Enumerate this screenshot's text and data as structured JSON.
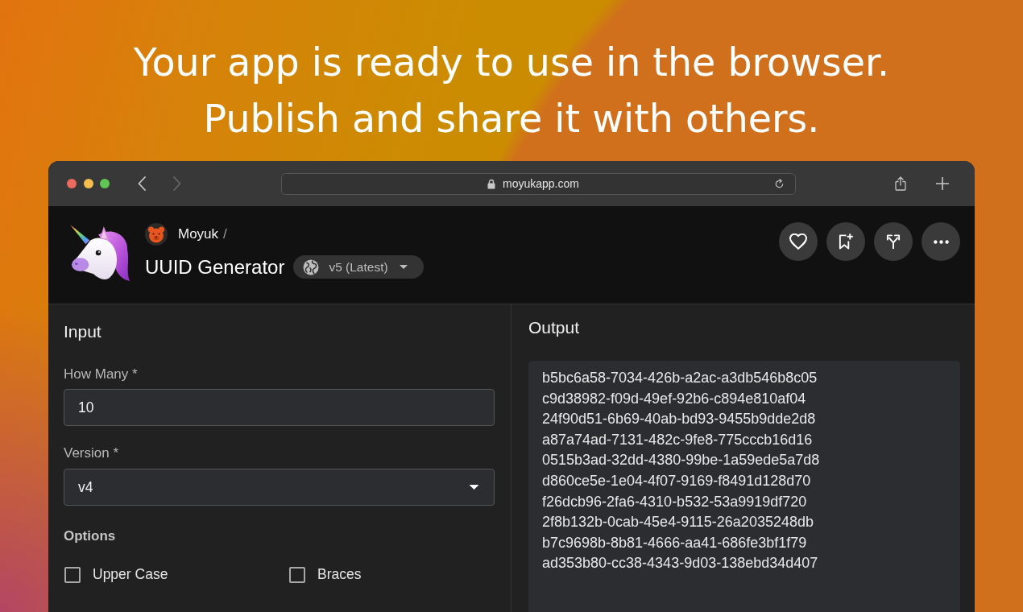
{
  "headline": [
    "Your app is ready to use in the browser.",
    "Publish and share it with others."
  ],
  "browser": {
    "nav": [
      {
        "kind": "back",
        "disabled": false
      },
      {
        "kind": "forward",
        "disabled": true
      }
    ],
    "url": "moyukapp.com"
  },
  "app": {
    "owner": "Moyuk",
    "separator": "/",
    "title": "UUID Generator",
    "version": "v5 (Latest)"
  },
  "input": {
    "heading": "Input",
    "fields": [
      {
        "kind": "number",
        "label": "How Many *",
        "value": "10"
      },
      {
        "kind": "select",
        "label": "Version *",
        "value": "v4"
      }
    ],
    "options_heading": "Options",
    "options": [
      {
        "label": "Upper Case",
        "checked": false
      },
      {
        "label": "Braces",
        "checked": false
      }
    ]
  },
  "output": {
    "heading": "Output",
    "lines": [
      "b5bc6a58-7034-426b-a2ac-a3db546b8c05",
      "c9d38982-f09d-49ef-92b6-c894e810af04",
      "24f90d51-6b69-40ab-bd93-9455b9dde2d8",
      "a87a74ad-7131-482c-9fe8-775cccb16d16",
      "0515b3ad-32dd-4380-99be-1a59ede5a7d8",
      "d860ce5e-1e04-4f07-9169-f8491d128d70",
      "f26dcb96-2fa6-4310-b532-53a9919df720",
      "2f8b132b-0cab-45e4-9115-26a2035248db",
      "b7c9698b-8b81-4666-aa41-686fe3bf1f79",
      "ad353b80-cc38-4343-9d03-138ebd34d407"
    ]
  }
}
